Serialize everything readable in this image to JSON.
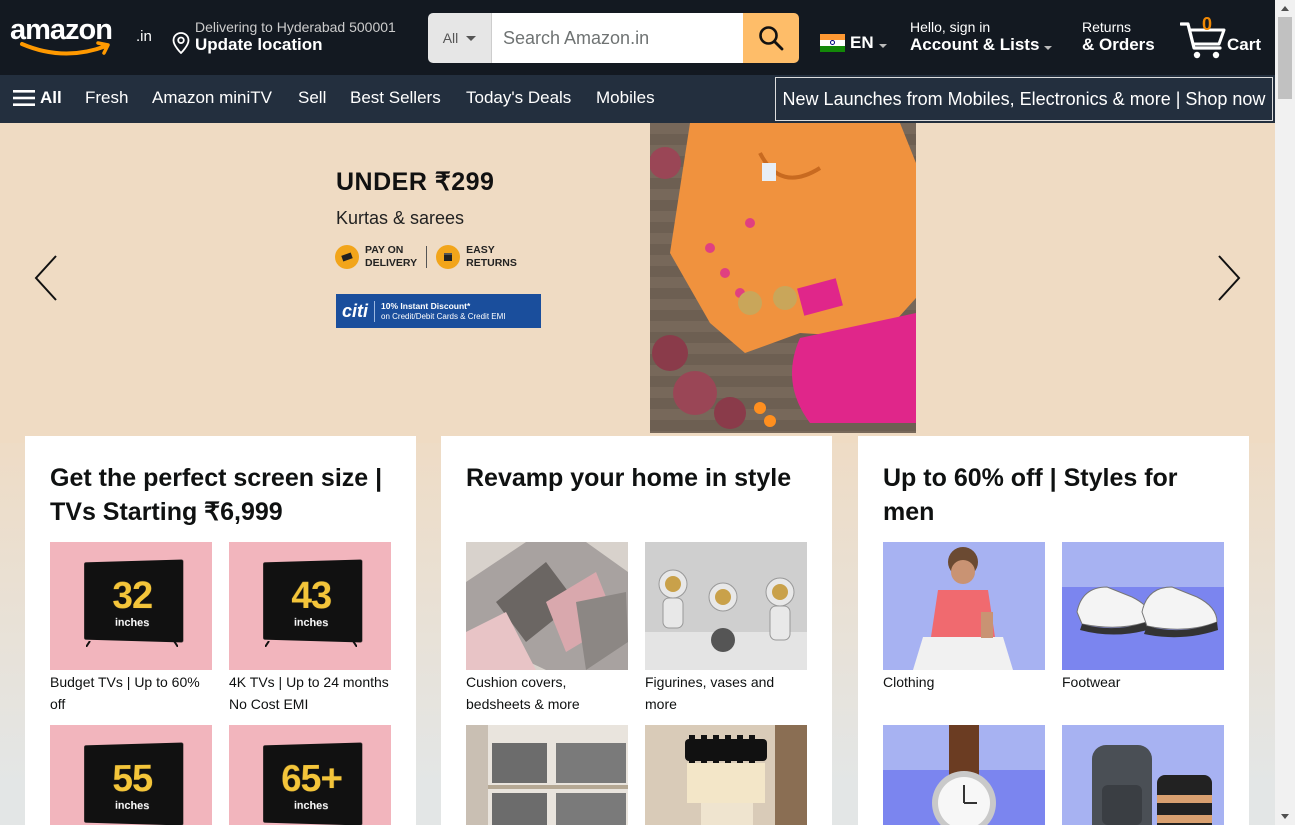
{
  "header": {
    "logo_text": "amazon",
    "logo_suffix": ".in",
    "deliver_line1": "Delivering to Hyderabad 500001",
    "deliver_line2": "Update location",
    "search_category": "All",
    "search_placeholder": "Search Amazon.in",
    "language": "EN",
    "account_line1": "Hello, sign in",
    "account_line2": "Account & Lists",
    "returns_line1": "Returns",
    "returns_line2": "& Orders",
    "cart_count": "0",
    "cart_label": "Cart"
  },
  "subnav": {
    "all_label": "All",
    "items": [
      "Fresh",
      "Amazon miniTV",
      "Sell",
      "Best Sellers",
      "Today's Deals",
      "Mobiles"
    ],
    "promo": "New Launches from Mobiles, Electronics & more | Shop now"
  },
  "hero": {
    "title": "UNDER ₹299",
    "subtitle": "Kurtas & sarees",
    "badge1_l1": "PAY ON",
    "badge1_l2": "DELIVERY",
    "badge2_l1": "EASY",
    "badge2_l2": "RETURNS",
    "bank_name": "citi",
    "bank_offer_l1": "10% Instant Discount*",
    "bank_offer_l2": "on Credit/Debit Cards & Credit EMI"
  },
  "cards": [
    {
      "title": "Get the perfect screen size | TVs Starting ₹6,999",
      "tiles": [
        {
          "caption": "Budget TVs | Up to 60% off",
          "size": "32"
        },
        {
          "caption": "4K TVs | Up to 24 months No Cost EMI",
          "size": "43"
        },
        {
          "caption": "",
          "size": "55"
        },
        {
          "caption": "",
          "size": "65+"
        }
      ],
      "tv_unit": "inches"
    },
    {
      "title": "Revamp your home in style",
      "tiles": [
        {
          "caption": "Cushion covers, bedsheets & more"
        },
        {
          "caption": "Figurines, vases and more"
        },
        {
          "caption": ""
        },
        {
          "caption": ""
        }
      ]
    },
    {
      "title": "Up to 60% off | Styles for men",
      "tiles": [
        {
          "caption": "Clothing"
        },
        {
          "caption": "Footwear"
        },
        {
          "caption": ""
        },
        {
          "caption": ""
        }
      ]
    }
  ],
  "colors": {
    "nav_top": "#131921",
    "nav_sub": "#232f3e",
    "search_button": "#febd69",
    "cart_count": "#f08804",
    "hero_bg": "#efdbc3"
  }
}
